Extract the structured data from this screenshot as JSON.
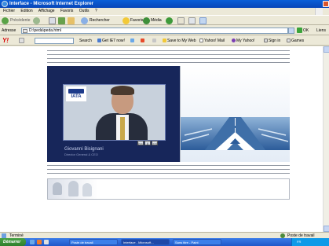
{
  "window": {
    "title": "Interface - Microsoft Internet Explorer"
  },
  "menubar": {
    "items": [
      "Fichier",
      "Edition",
      "Affichage",
      "Favoris",
      "Outils",
      "?"
    ]
  },
  "toolbar": {
    "back": "Précédente",
    "search": "Rechercher",
    "favorites": "Favoris",
    "media": "Média"
  },
  "address": {
    "label": "Adresse",
    "value": "D:\\peda\\peda.html",
    "go": "OK",
    "links": "Liens"
  },
  "yahoo": {
    "logo": "Y!",
    "search_btn": "Search",
    "items": [
      "Get IE7 now!",
      "Save to My Web",
      "Yahoo! Mail",
      "My Yahoo!",
      "Sign in",
      "Games"
    ]
  },
  "video": {
    "logo_text": "IATA",
    "controls": [
      "|<<",
      "||",
      ">>|"
    ],
    "name": "Giovanni Bisignani",
    "title": "Director General & CEO"
  },
  "statusbar": {
    "left": "Terminé",
    "right": "Poste de travail"
  },
  "taskbar": {
    "start": "Démarrer",
    "tasks": [
      "Poste de travail",
      "Interface - Microsoft...",
      "Sans titre - Paint"
    ],
    "tray": "FR"
  }
}
